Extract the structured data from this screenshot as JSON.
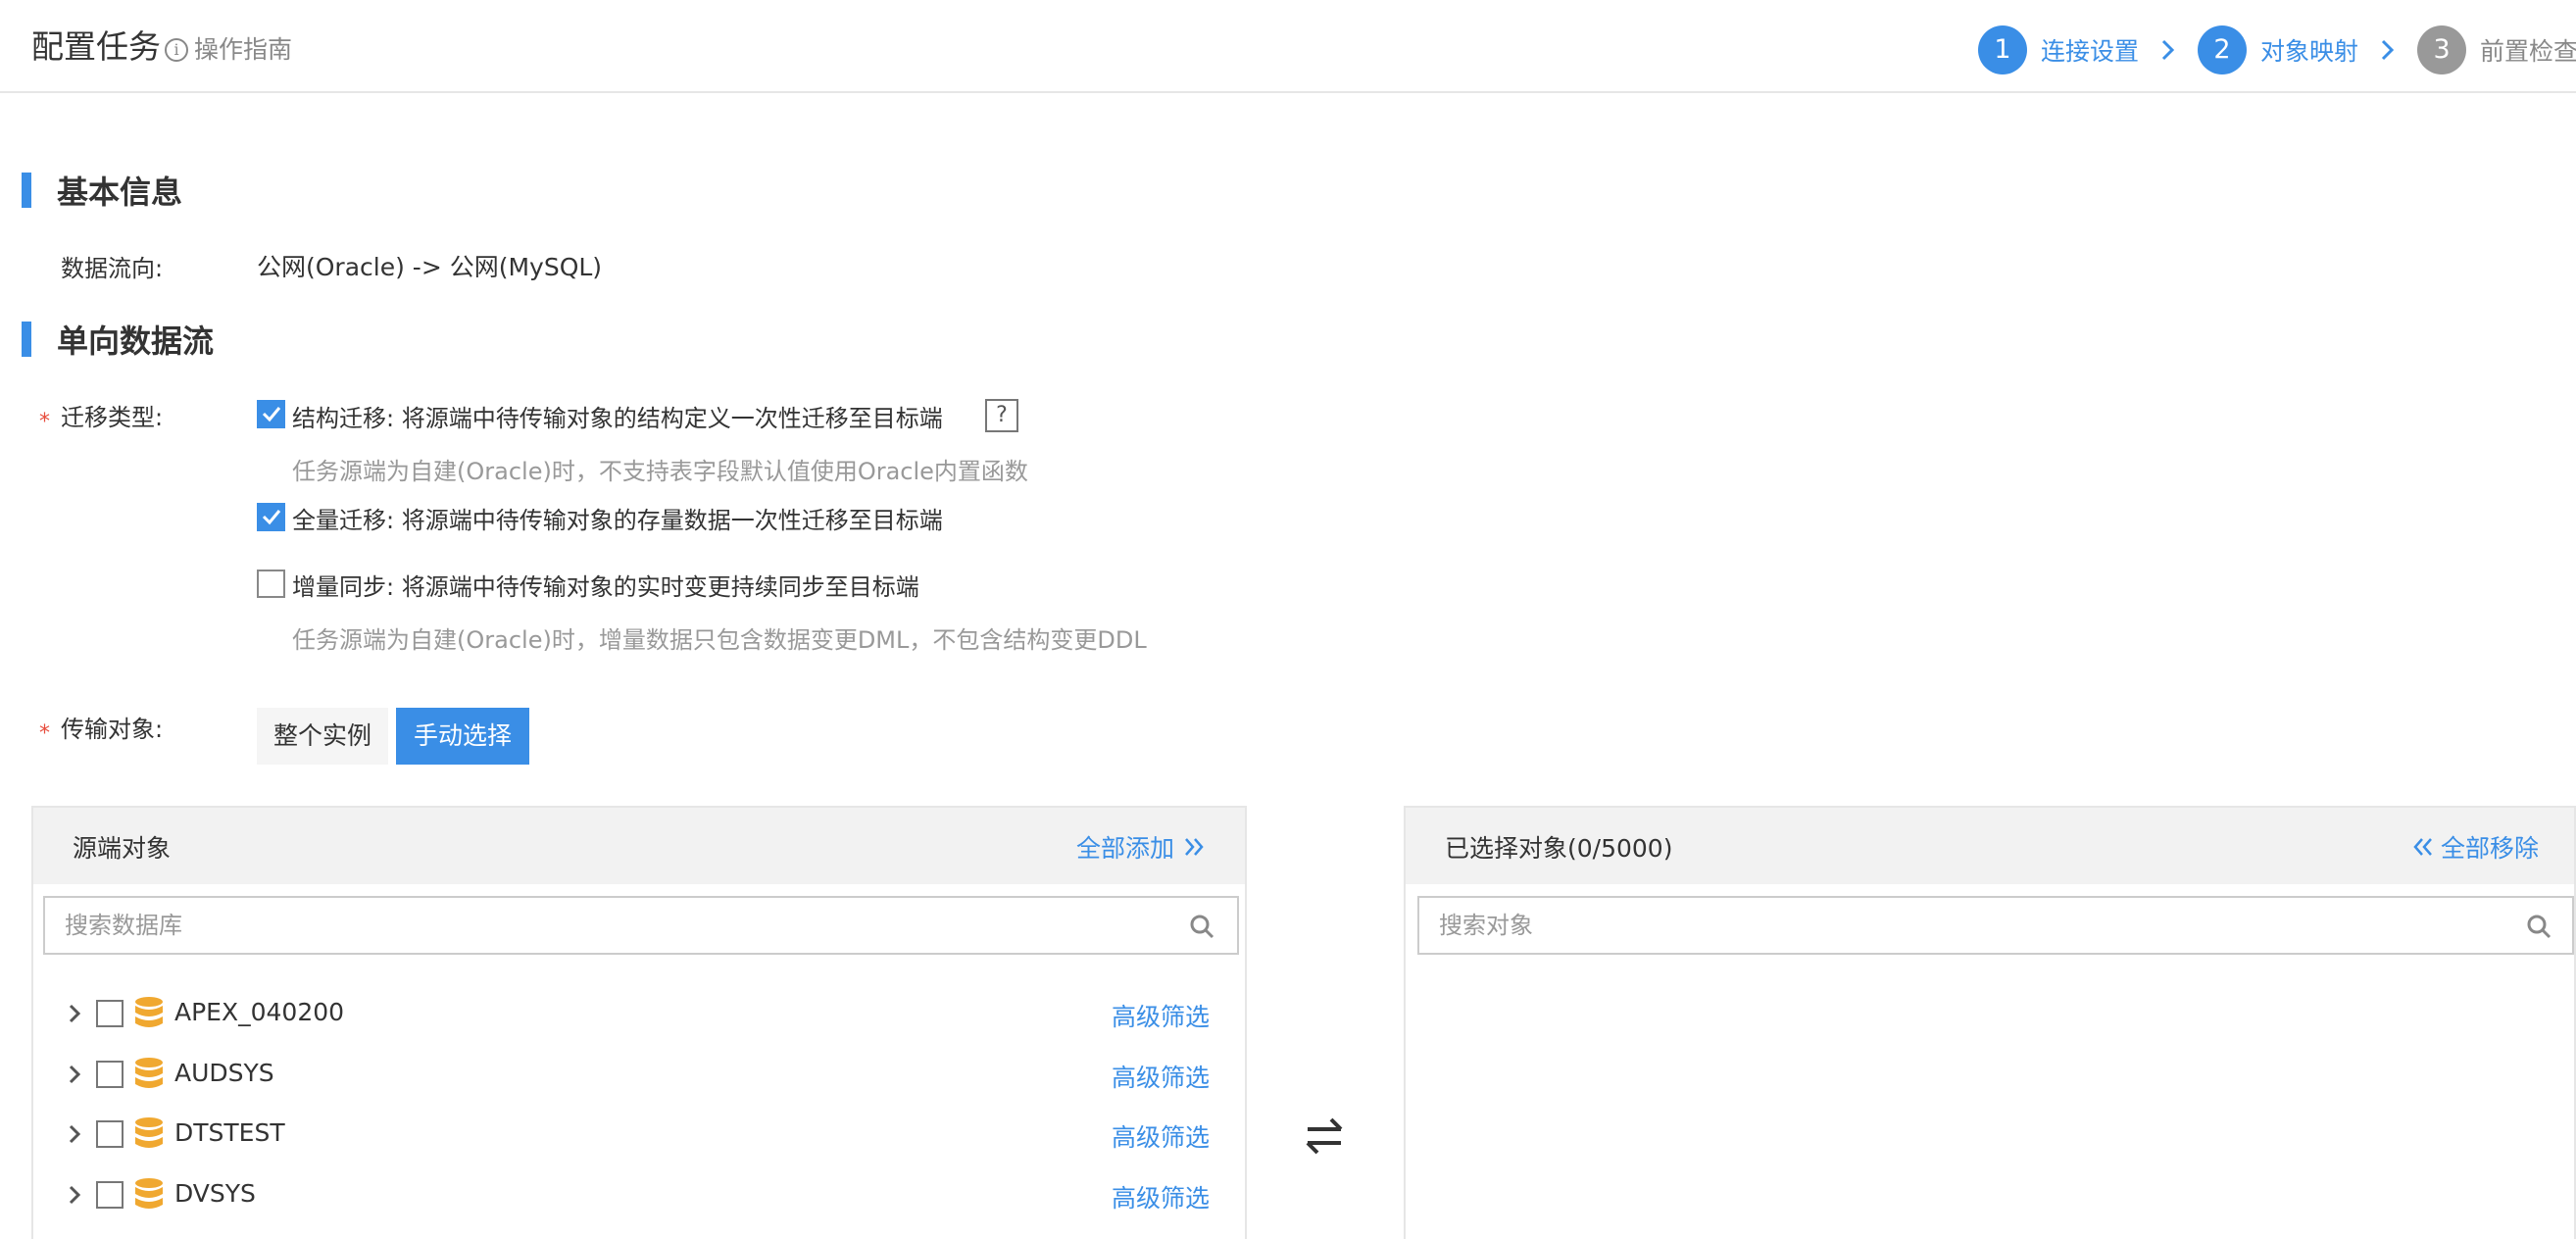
{
  "header": {
    "title": "配置任务",
    "guide": "操作指南",
    "steps": [
      {
        "num": "1",
        "label": "连接设置",
        "state": "done"
      },
      {
        "num": "2",
        "label": "对象映射",
        "state": "active"
      },
      {
        "num": "3",
        "label": "前置检查",
        "state": "pending"
      }
    ]
  },
  "basic_info": {
    "title": "基本信息",
    "data_flow_label": "数据流向:",
    "data_flow_value": "公网(Oracle) -> 公网(MySQL)"
  },
  "unidirectional": {
    "title": "单向数据流",
    "migration_type_label": "迁移类型:",
    "options": [
      {
        "label": "结构迁移: 将源端中待传输对象的结构定义一次性迁移至目标端",
        "checked": true,
        "hint": "任务源端为自建(Oracle)时，不支持表字段默认值使用Oracle内置函数"
      },
      {
        "label": "全量迁移: 将源端中待传输对象的存量数据一次性迁移至目标端",
        "checked": true,
        "hint": ""
      },
      {
        "label": "增量同步: 将源端中待传输对象的实时变更持续同步至目标端",
        "checked": false,
        "hint": "任务源端为自建(Oracle)时，增量数据只包含数据变更DML，不包含结构变更DDL"
      }
    ],
    "help": "?",
    "transfer_label": "传输对象:",
    "transfer_modes": [
      {
        "label": "整个实例",
        "active": false
      },
      {
        "label": "手动选择",
        "active": true
      }
    ]
  },
  "source_panel": {
    "title": "源端对象",
    "add_all": "全部添加",
    "search_placeholder": "搜索数据库",
    "items": [
      {
        "name": "APEX_040200",
        "filter": "高级筛选"
      },
      {
        "name": "AUDSYS",
        "filter": "高级筛选"
      },
      {
        "name": "DTSTEST",
        "filter": "高级筛选"
      },
      {
        "name": "DVSYS",
        "filter": "高级筛选"
      }
    ]
  },
  "selected_panel": {
    "title": "已选择对象(0/5000)",
    "remove_all": "全部移除",
    "search_placeholder": "搜索对象"
  },
  "colors": {
    "accent": "#3a8ee6",
    "required": "#e74c3c",
    "db_icon": "#f0a830"
  }
}
